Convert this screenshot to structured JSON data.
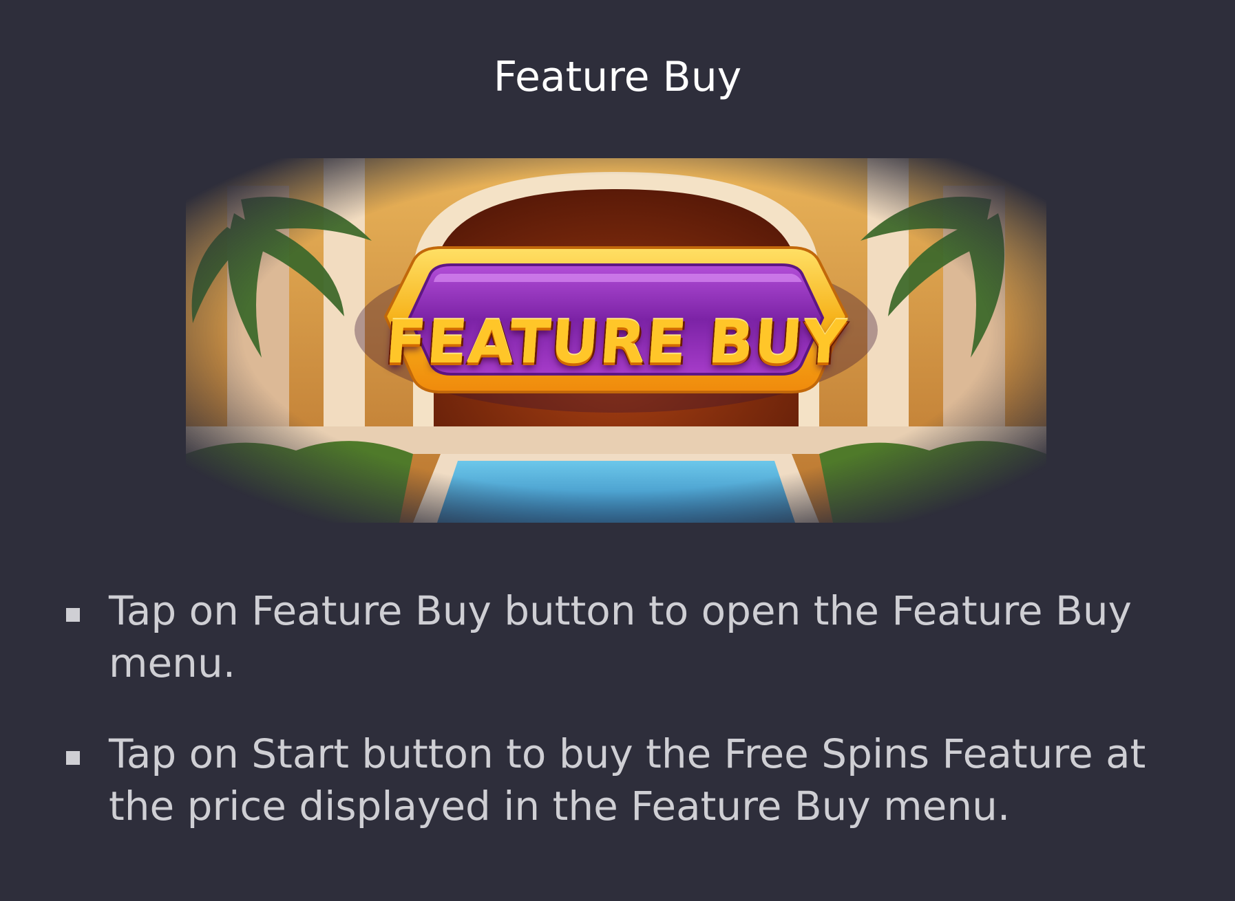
{
  "page_title": "Feature Buy",
  "banner": {
    "label": "FEATURE BUY",
    "colors": {
      "button_fill": "#8a2bb0",
      "button_frame": "#f6b21a",
      "label_text": "#ffc629",
      "pool": "#3fa9d6",
      "foliage": "#4f7a2a",
      "arch": "#7a2a0c"
    }
  },
  "instructions": [
    {
      "text": "Tap on Feature Buy button to open the Feature Buy menu."
    },
    {
      "text": "Tap on Start button to buy the Free Spins Feature at the price displayed in the Feature Buy menu."
    }
  ],
  "colors": {
    "background": "#2e2e3b",
    "title_text": "#ffffff",
    "body_text": "#cfcfd4"
  }
}
